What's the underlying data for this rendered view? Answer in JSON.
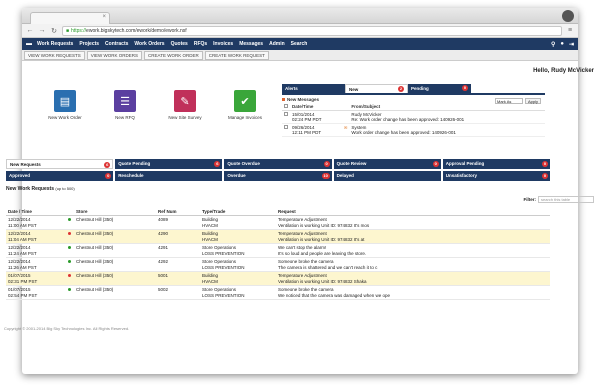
{
  "browser": {
    "url_scheme": "https://",
    "url_rest": "ework.bigskytech.com/ework/demo/ework.nsf"
  },
  "appnav": {
    "items": [
      "Work Requests",
      "Projects",
      "Contracts",
      "Work Orders",
      "Quotes",
      "RFQs",
      "Invoices",
      "Messages",
      "Admin",
      "Search"
    ]
  },
  "subnav": {
    "buttons": [
      "VIEW WORK REQUESTS",
      "VIEW WORK ORDERS",
      "CREATE WORK ORDER",
      "CREATE WORK REQUEST"
    ]
  },
  "greeting": "Hello, Rudy McVicker",
  "shortcuts": [
    {
      "label": "New Work Order",
      "color": "#2a6fb0",
      "icon": "document-icon"
    },
    {
      "label": "New RFQ",
      "color": "#5b3fa0",
      "icon": "list-icon"
    },
    {
      "label": "New Site Survey",
      "color": "#c0305a",
      "icon": "edit-icon"
    },
    {
      "label": "Manage Invoices",
      "color": "#3aa63a",
      "icon": "check-icon"
    }
  ],
  "messages": {
    "tabs": [
      {
        "label": "Alerts",
        "badge": ""
      },
      {
        "label": "New",
        "badge": "2"
      },
      {
        "label": "Pending",
        "badge": "0"
      }
    ],
    "heading": "New Messages",
    "mark_as": "Mark As",
    "apply": "Apply",
    "columns": [
      "Date/Time",
      "From/Subject"
    ],
    "rows": [
      {
        "date": "15/01/2014",
        "time": "02:24 PM PDT",
        "from": "Rudy McVicker",
        "subject": "Re: Work order change has been approved: 140926-001"
      },
      {
        "date": "09/26/2014",
        "time": "12:11 PM PDT",
        "from": "System",
        "subject": "Work order change has been approved: 140926-001"
      }
    ]
  },
  "stats": [
    {
      "label": "New Requests",
      "badge": "6"
    },
    {
      "label": "Quote Pending",
      "badge": "6"
    },
    {
      "label": "Quote Overdue",
      "badge": "0"
    },
    {
      "label": "Quote Review",
      "badge": "0"
    },
    {
      "label": "Approval Pending",
      "badge": "0"
    },
    {
      "label": "Approved",
      "badge": "0"
    },
    {
      "label": "Reschedule",
      "badge": ""
    },
    {
      "label": "Overdue",
      "badge": "10"
    },
    {
      "label": "Delayed",
      "badge": ""
    },
    {
      "label": "Unsatisfactory",
      "badge": "0"
    }
  ],
  "work_requests": {
    "title": "New Work Requests",
    "subtitle": "(up to 500)",
    "filter_label": "Filter:",
    "filter_placeholder": "search this table",
    "columns": [
      "Date / Time",
      "Store",
      "Ref Num",
      "Type/Trade",
      "Request"
    ],
    "rows": [
      {
        "date": "12/22/2014",
        "time": "11:00 AM PST",
        "status": "#2a9a2a",
        "store": "Chestnut Hill (350)",
        "ref": "4089",
        "type": "Building",
        "trade": "HVACM",
        "req1": "Temperature Adjustment",
        "req2": "Ventilation is working Unit ID: 974832 It's mos",
        "hl": false
      },
      {
        "date": "12/22/2014",
        "time": "11:04 AM PST",
        "status": "#d33",
        "store": "Chestnut Hill (350)",
        "ref": "4290",
        "type": "Building",
        "trade": "HVACM",
        "req1": "Temperature Adjustment",
        "req2": "Ventilation is working Unit ID: 974832 It's at",
        "hl": true
      },
      {
        "date": "12/22/2014",
        "time": "11:24 AM PST",
        "status": "#2a9a2a",
        "store": "Chestnut Hill (350)",
        "ref": "4291",
        "type": "Store Operations",
        "trade": "LOSS PREVENTION",
        "req1": "We can't stop the alarm!",
        "req2": "It's so loud and people are leaving the store.",
        "hl": false
      },
      {
        "date": "12/22/2014",
        "time": "11:26 AM PST",
        "status": "#2a9a2a",
        "store": "Chestnut Hill (350)",
        "ref": "4292",
        "type": "Store Operations",
        "trade": "LOSS PREVENTION",
        "req1": "Someone broke the camera",
        "req2": "The camera is shattered and we can't reach it to c",
        "hl": false
      },
      {
        "date": "01/07/2015",
        "time": "02:31 PM PST",
        "status": "#d33",
        "store": "Chestnut Hill (350)",
        "ref": "5001",
        "type": "Building",
        "trade": "HVACM",
        "req1": "Temperature Adjustment",
        "req2": "Ventilation is working Unit ID: 974832 Shaka",
        "hl": true
      },
      {
        "date": "01/07/2015",
        "time": "02:54 PM PST",
        "status": "#2a9a2a",
        "store": "Chestnut Hill (350)",
        "ref": "5002",
        "type": "Store Operations",
        "trade": "LOSS PREVENTION",
        "req1": "Someone broke the camera",
        "req2": "We noticed that the camera was damaged when we ope",
        "hl": false
      }
    ]
  },
  "footer": "Copyright © 2001-2014 Big Sky Technologies Inc. All Rights Reserved."
}
